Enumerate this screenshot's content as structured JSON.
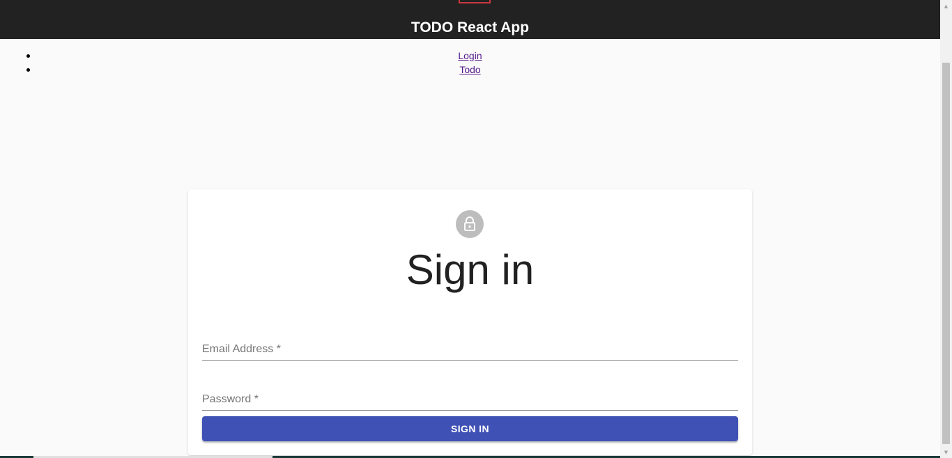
{
  "header": {
    "title": "TODO React App",
    "logo_icon": "react-logo-icon"
  },
  "nav": {
    "items": [
      {
        "label": "Login"
      },
      {
        "label": "Todo"
      }
    ]
  },
  "signin": {
    "avatar_icon": "lock-icon",
    "heading": "Sign in",
    "email_label": "Email Address *",
    "password_label": "Password *",
    "button_label": "SIGN IN"
  },
  "colors": {
    "header_bg": "#222222",
    "accent": "#3f51b5",
    "avatar_bg": "#bdbdbd",
    "link": "#551a8b"
  }
}
